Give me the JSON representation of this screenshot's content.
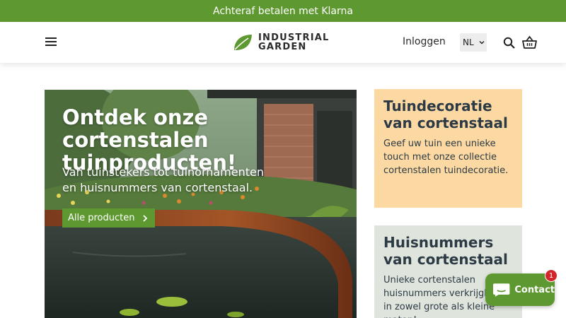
{
  "announcement": {
    "text": "Achteraf betalen met Klarna"
  },
  "header": {
    "logo": {
      "line1": "INDUSTRIAL",
      "line2": "GARDEN"
    },
    "login_label": "Inloggen",
    "language": {
      "selected": "NL"
    },
    "icons": [
      "menu-icon",
      "leaf-logo-icon",
      "search-icon",
      "cart-icon",
      "chevron-down-icon"
    ]
  },
  "hero": {
    "title": "Ontdek onze cortenstalen tuinproducten!",
    "subtitle": "Van tuinstekers tot tuinornamenten en huisnummers van cortenstaal.",
    "button_label": "Alle producten"
  },
  "cards": [
    {
      "title": "Tuindecoratie van cortenstaal",
      "text": "Geef uw tuin een unieke touch met onze collectie cortenstalen tuindecoratie."
    },
    {
      "title": "Huisnummers van cortenstaal",
      "text": "Unieke cortenstalen huisnummers verkrijgbaar in zowel grote als kleine maten!"
    }
  ],
  "contact_widget": {
    "label": "Contact",
    "badge": "1"
  },
  "colors": {
    "brand_green": "#5e9830",
    "card1_bg": "#fcd9a3",
    "card2_bg": "#dfe4dc",
    "text_dark": "#2c3a45",
    "badge_red": "#d3262a"
  }
}
